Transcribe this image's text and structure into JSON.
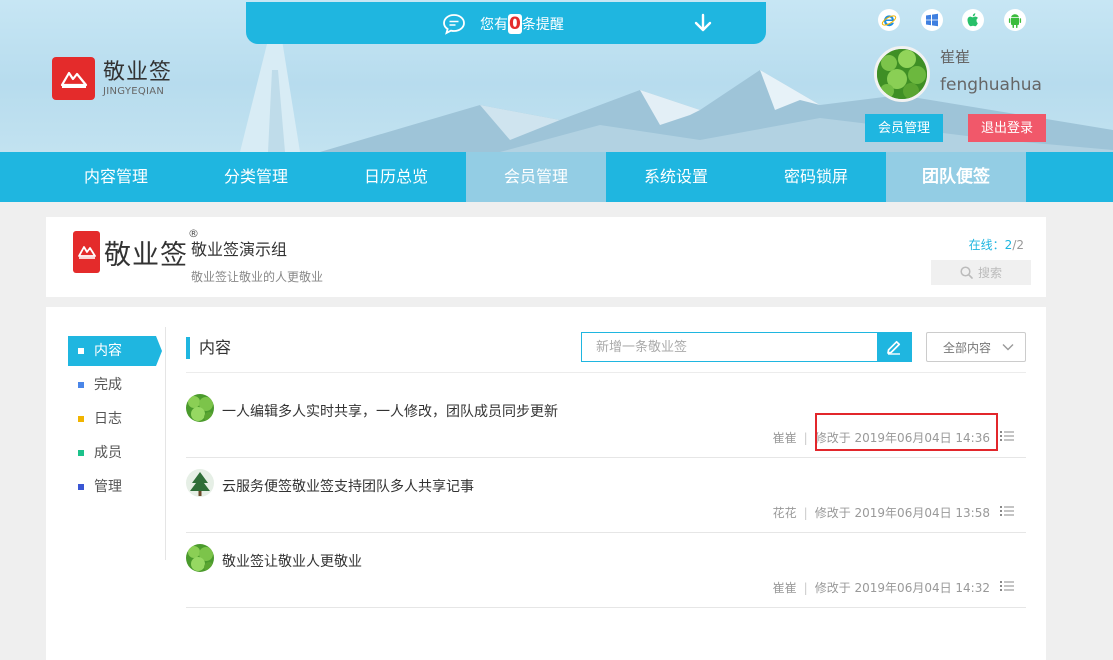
{
  "brand": {
    "name_cn": "敬业签",
    "name_en": "JINGYEQIAN",
    "registered_mark": "®"
  },
  "notice": {
    "prefix": "您有",
    "count": "0",
    "suffix": "条提醒"
  },
  "platforms": [
    "ie-icon",
    "windows-icon",
    "apple-icon",
    "android-icon"
  ],
  "user": {
    "nickname": "崔崔",
    "username": "fenghuahua"
  },
  "header_buttons": {
    "member": "会员管理",
    "logout": "退出登录"
  },
  "nav": {
    "items": [
      "内容管理",
      "分类管理",
      "日历总览",
      "会员管理",
      "系统设置",
      "密码锁屏",
      "团队便签"
    ]
  },
  "group": {
    "name": "敬业签演示组",
    "slogan": "敬业签让敬业的人更敬业",
    "online_label": "在线：",
    "online_count": "2",
    "online_sep": "/",
    "online_total": "2",
    "search_label": "搜索"
  },
  "sidebar": {
    "items": [
      {
        "label": "内容",
        "color": "#e42b2b"
      },
      {
        "label": "完成",
        "color": "#4a86e8"
      },
      {
        "label": "日志",
        "color": "#f1b400"
      },
      {
        "label": "成员",
        "color": "#1cc28b"
      },
      {
        "label": "管理",
        "color": "#3a56d4"
      }
    ]
  },
  "content": {
    "title": "内容",
    "new_placeholder": "新增一条敬业签",
    "filter_label": "全部内容",
    "notes": [
      {
        "text": "一人编辑多人实时共享，一人修改，团队成员同步更新",
        "author": "崔崔",
        "modified": "修改于 2019年06月04日 14:36"
      },
      {
        "text": "云服务便签敬业签支持团队多人共享记事",
        "author": "花花",
        "modified": "修改于 2019年06月04日 13:58"
      },
      {
        "text": "敬业签让敬业人更敬业",
        "author": "崔崔",
        "modified": "修改于 2019年06月04日 14:32"
      }
    ]
  },
  "colors": {
    "accent": "#1fb6e0",
    "brand_red": "#e42b2b",
    "logout": "#f1586a",
    "highlight": "#e2262b"
  }
}
